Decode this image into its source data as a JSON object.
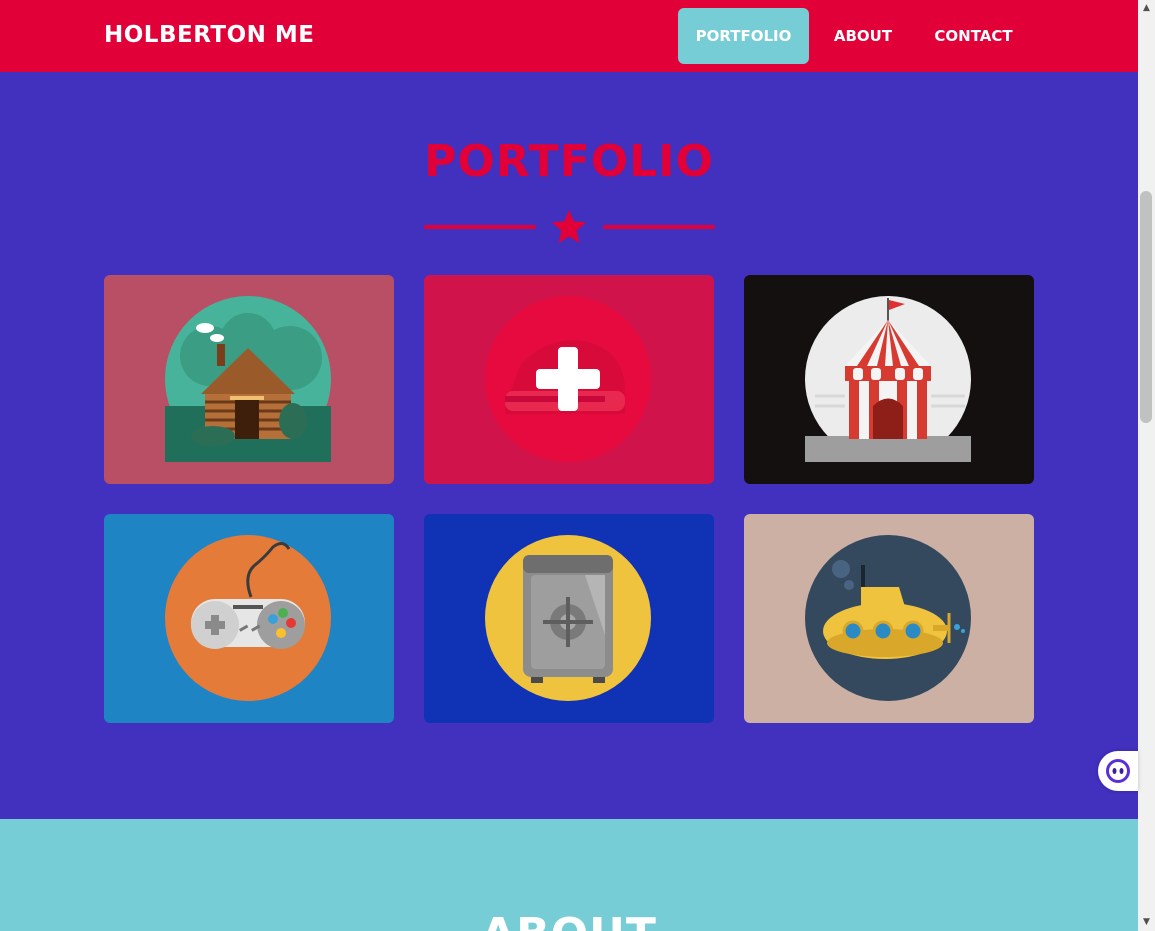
{
  "nav": {
    "brand": "HOLBERTON ME",
    "items": [
      {
        "label": "PORTFOLIO",
        "active": true
      },
      {
        "label": "ABOUT",
        "active": false
      },
      {
        "label": "CONTACT",
        "active": false
      }
    ]
  },
  "portfolio": {
    "title": "PORTFOLIO",
    "divider_icon": "star-icon",
    "items": [
      {
        "icon": "cabin-icon",
        "background": "#b94f65"
      },
      {
        "icon": "cake-icon",
        "background": "#d0134a",
        "hover_icon": "plus-icon"
      },
      {
        "icon": "circus-tent-icon",
        "background": "#141010"
      },
      {
        "icon": "game-controller-icon",
        "background": "#1f84c4"
      },
      {
        "icon": "safe-icon",
        "background": "#1032b5"
      },
      {
        "icon": "submarine-icon",
        "background": "#ccb0a4"
      }
    ]
  },
  "about": {
    "title": "ABOUT"
  },
  "colors": {
    "primary": "#e10037",
    "accent": "#77cdd5",
    "background": "#4230bf"
  },
  "chat_widget": {
    "icon": "chat-bot-icon"
  }
}
